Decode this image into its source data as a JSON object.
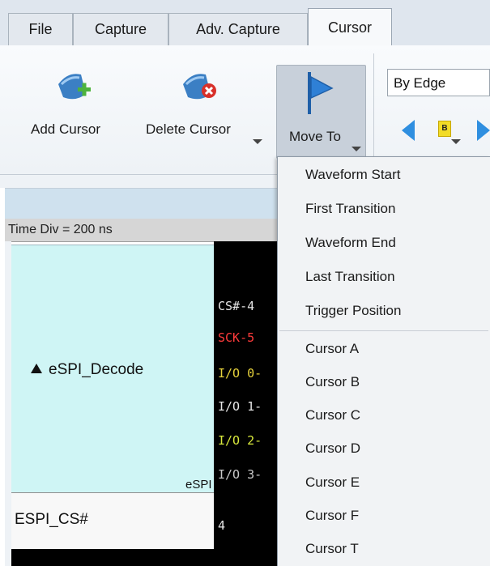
{
  "tabs": [
    {
      "label": "File",
      "active": false
    },
    {
      "label": "Capture",
      "active": false
    },
    {
      "label": "Adv. Capture",
      "active": false
    },
    {
      "label": "Cursor",
      "active": true
    }
  ],
  "ribbon": {
    "add_cursor": "Add Cursor",
    "delete_cursor": "Delete Cursor",
    "move_to": "Move To",
    "edge_mode": "By Edge",
    "cursor_badge": "B"
  },
  "panel": {
    "time_div": "Time Div = 200 ns",
    "decode_label": "eSPI_Decode",
    "decode_clip": "eSPI",
    "cs_label": "ESPI_CS#"
  },
  "signals": [
    {
      "text": "CS#-4",
      "color": "#e6e6e6"
    },
    {
      "text": "SCK-5",
      "color": "#ff3b3b"
    },
    {
      "text": "I/O 0-",
      "color": "#e6d23c"
    },
    {
      "text": "I/O 1-",
      "color": "#e6e6e6"
    },
    {
      "text": "I/O 2-",
      "color": "#d8e83c"
    },
    {
      "text": "I/O 3-",
      "color": "#c9c9c9"
    }
  ],
  "cs_value": "4",
  "move_to_menu": {
    "group1": [
      "Waveform Start",
      "First Transition",
      "Waveform End",
      "Last Transition",
      "Trigger Position"
    ],
    "group2": [
      "Cursor A",
      "Cursor B",
      "Cursor C",
      "Cursor D",
      "Cursor E",
      "Cursor F",
      "Cursor T"
    ]
  },
  "colors": {
    "ribbon_icon_blue": "#3b7fc4",
    "add_plus_green": "#4db33d",
    "delete_x_red": "#d8302a",
    "nav_arrow_blue": "#2f8fe0",
    "badge_yellow": "#f2dc27"
  }
}
